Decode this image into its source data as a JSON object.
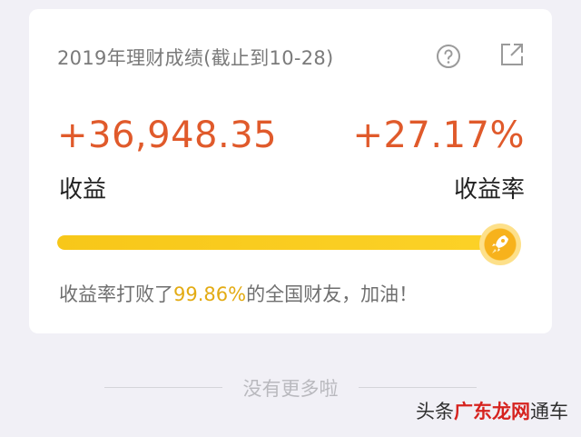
{
  "card": {
    "title": "2019年理财成绩(截止到10-28)",
    "amount": "+36,948.35",
    "amount_label": "收益",
    "rate": "+27.17%",
    "rate_label": "收益率",
    "progress_fraction": 0.9986,
    "beat_prefix": "收益率打败了",
    "beat_percent": "99.86%",
    "beat_suffix": "的全国财友，加油！"
  },
  "footer": {
    "no_more": "没有更多啦"
  },
  "watermark": {
    "prefix": "头条",
    "brand": "广东龙网",
    "suffix": "通车"
  },
  "colors": {
    "accent_red": "#e05a2b",
    "progress_yellow": "#f7c719",
    "highlight_yellow": "#e3ab13",
    "background": "#f1f0f6"
  },
  "icons": [
    "help-circle-icon",
    "external-link-icon",
    "rocket-icon"
  ]
}
